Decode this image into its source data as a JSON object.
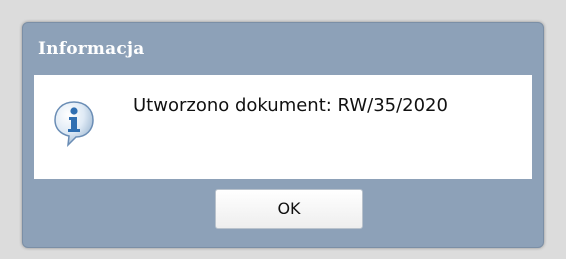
{
  "dialog": {
    "title": "Informacja",
    "message": "Utworzono dokument: RW/35/2020",
    "icon": "info-icon",
    "ok_label": "OK"
  },
  "colors": {
    "backdrop": "#dcdcdc",
    "dialog_frame": "#8da1b8",
    "content_background": "#ffffff",
    "title_text": "#ffffff",
    "icon_blue": "#2f6fb2"
  }
}
